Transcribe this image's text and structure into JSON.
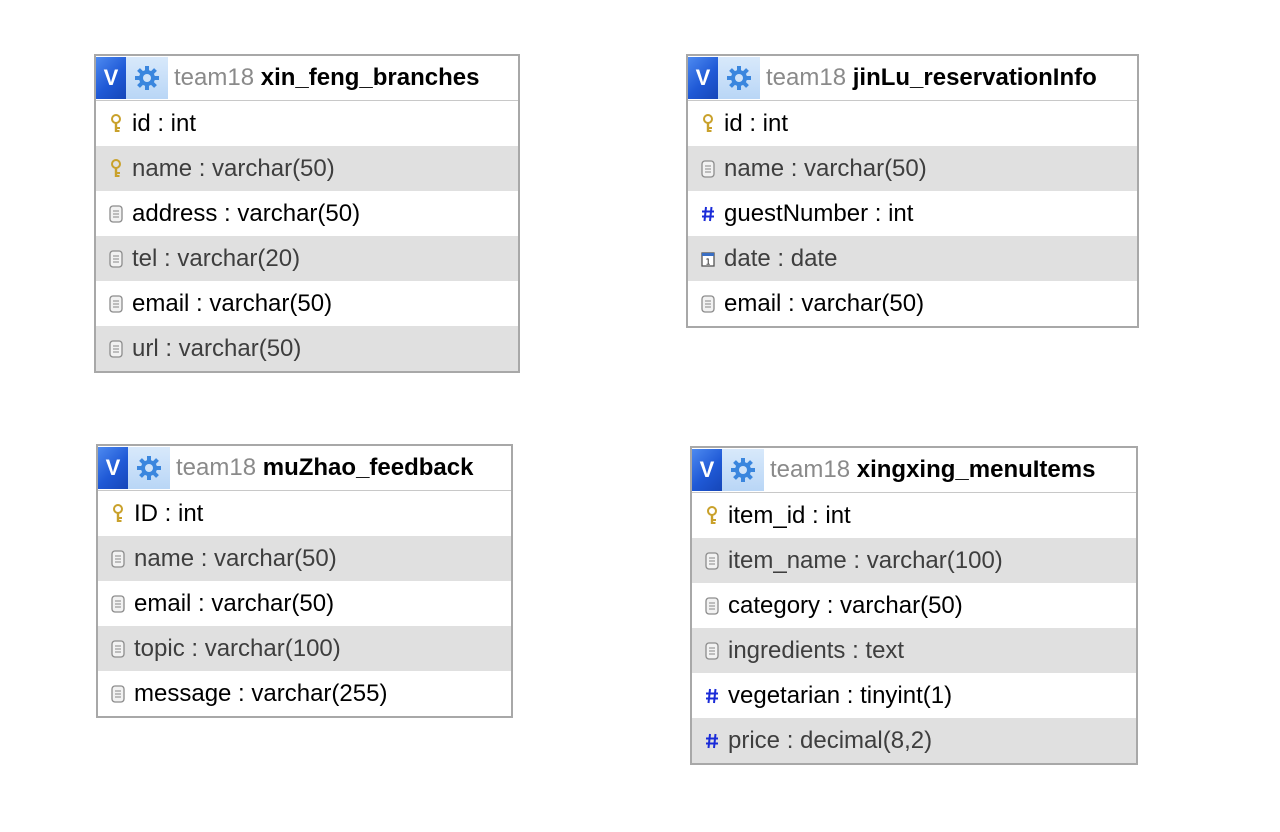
{
  "tables": [
    {
      "db": "team18",
      "name": "xin_feng_branches",
      "v_label": "V",
      "columns": [
        {
          "label": "id : int",
          "icon": "key-icon"
        },
        {
          "label": "name : varchar(50)",
          "icon": "key-icon"
        },
        {
          "label": "address : varchar(50)",
          "icon": "text-field-icon"
        },
        {
          "label": "tel : varchar(20)",
          "icon": "text-field-icon"
        },
        {
          "label": "email : varchar(50)",
          "icon": "text-field-icon"
        },
        {
          "label": "url : varchar(50)",
          "icon": "text-field-icon"
        }
      ]
    },
    {
      "db": "team18",
      "name": "jinLu_reservationInfo",
      "v_label": "V",
      "columns": [
        {
          "label": "id : int",
          "icon": "key-icon"
        },
        {
          "label": "name : varchar(50)",
          "icon": "text-field-icon"
        },
        {
          "label": "guestNumber : int",
          "icon": "number-icon"
        },
        {
          "label": "date : date",
          "icon": "calendar-icon"
        },
        {
          "label": "email : varchar(50)",
          "icon": "text-field-icon"
        }
      ]
    },
    {
      "db": "team18",
      "name": "muZhao_feedback",
      "v_label": "V",
      "columns": [
        {
          "label": "ID : int",
          "icon": "key-icon"
        },
        {
          "label": "name : varchar(50)",
          "icon": "text-field-icon"
        },
        {
          "label": "email : varchar(50)",
          "icon": "text-field-icon"
        },
        {
          "label": "topic : varchar(100)",
          "icon": "text-field-icon"
        },
        {
          "label": "message : varchar(255)",
          "icon": "text-field-icon"
        }
      ]
    },
    {
      "db": "team18",
      "name": "xingxing_menuItems",
      "v_label": "V",
      "columns": [
        {
          "label": "item_id : int",
          "icon": "key-icon"
        },
        {
          "label": "item_name : varchar(100)",
          "icon": "text-field-icon"
        },
        {
          "label": "category : varchar(50)",
          "icon": "text-field-icon"
        },
        {
          "label": "ingredients : text",
          "icon": "text-field-icon"
        },
        {
          "label": "vegetarian : tinyint(1)",
          "icon": "number-icon"
        },
        {
          "label": "price : decimal(8,2)",
          "icon": "number-icon"
        }
      ]
    }
  ],
  "colors": {
    "header_v": "#1f59d6",
    "header_gear_bg": "#b9d6f6",
    "gear": "#3a86de",
    "alt_row": "#e0e0e0",
    "border": "#a8a8a8",
    "db_text": "#8a8a8a",
    "number_icon": "#1a2bd8",
    "key_icon": "#c9a12b"
  }
}
